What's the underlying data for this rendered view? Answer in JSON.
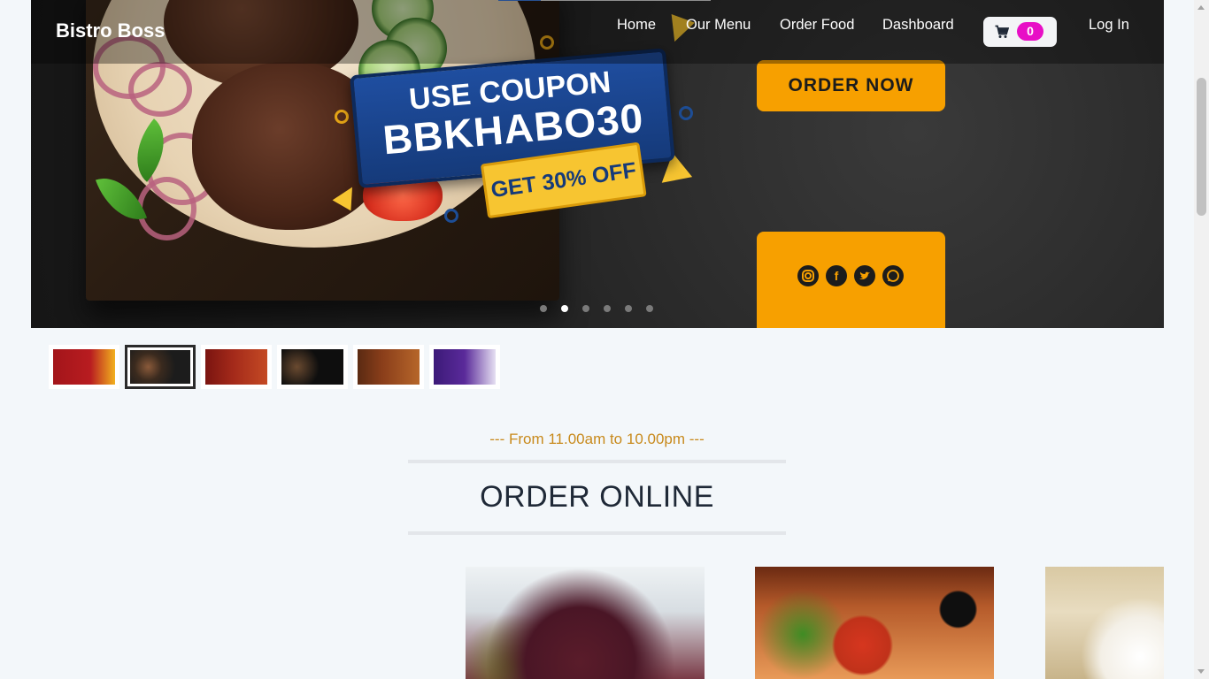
{
  "navbar": {
    "brand": "Bistro Boss",
    "links": [
      "Home",
      "Our Menu",
      "Order Food",
      "Dashboard"
    ],
    "cart_count": "0",
    "login": "Log In"
  },
  "hero": {
    "coupon_line1": "USE COUPON",
    "coupon_code": "BBKHABO30",
    "coupon_offer": "GET 30% OFF",
    "cta": "ORDER NOW",
    "social_icons": [
      "instagram-icon",
      "facebook-icon",
      "twitter-icon",
      "whatsapp-icon"
    ],
    "slide_count": 6,
    "active_slide": 2
  },
  "thumbnails": [
    {
      "name": "thumb-menu-red",
      "colors": [
        "#a3151a",
        "#f2b01e"
      ]
    },
    {
      "name": "thumb-delicious-taste",
      "colors": [
        "#1c1c1c",
        "#3a3a3a"
      ]
    },
    {
      "name": "thumb-20-percent",
      "colors": [
        "#7a1410",
        "#c44a24"
      ]
    },
    {
      "name": "thumb-menu-dark",
      "colors": [
        "#0e0e0e",
        "#2c2c2c"
      ]
    },
    {
      "name": "thumb-50-percent",
      "colors": [
        "#5a2a12",
        "#b6662a"
      ]
    },
    {
      "name": "thumb-30-percent-purple",
      "colors": [
        "#3c1a78",
        "#6a2fb0"
      ]
    }
  ],
  "active_thumbnail": 2,
  "section": {
    "subheading": "--- From 11.00am to 10.00pm ---",
    "heading": "ORDER ONLINE"
  },
  "colors": {
    "accent": "#f7a000",
    "badge": "#e80fc6",
    "subheading": "#c88a1c"
  }
}
